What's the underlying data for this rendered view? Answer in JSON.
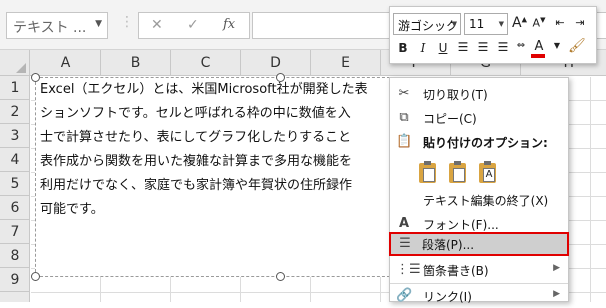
{
  "formula_bar": {
    "name_box": "テキスト ...",
    "cancel_icon": "✕",
    "enter_icon": "✓",
    "fx_label": "fx"
  },
  "columns": [
    "A",
    "B",
    "C",
    "D",
    "E",
    "F",
    "G",
    "H"
  ],
  "rows": [
    "1",
    "2",
    "3",
    "4",
    "5",
    "6",
    "7",
    "8",
    "9"
  ],
  "textbox": {
    "lines": [
      "Excel（エクセル）とは、米国Microsoft社が開発した表",
      "ションソフトです。セルと呼ばれる枠の中に数値を入",
      "士で計算させたり、表にしてグラフ化したりすること",
      "表作成から関数を用いた複雑な計算まで多用な機能を",
      "利用だけでなく、家庭でも家計簿や年賀状の住所録作",
      "可能です。"
    ]
  },
  "mini_toolbar": {
    "font_name": "游ゴシック",
    "font_size": "11",
    "grow_font": "A",
    "shrink_font": "A",
    "bold": "B",
    "italic": "I",
    "underline": "U",
    "font_color": "A",
    "font_color_hex": "#e00000"
  },
  "context_menu": {
    "items": [
      {
        "label": "切り取り(T)",
        "icon": "scissors-icon"
      },
      {
        "label": "コピー(C)",
        "icon": "copy-icon"
      },
      {
        "label": "貼り付けのオプション:",
        "icon": "paste-icon"
      },
      {
        "label": "テキスト編集の終了(X)",
        "icon": ""
      },
      {
        "label": "フォント(F)...",
        "icon": "font-icon"
      },
      {
        "label": "段落(P)...",
        "icon": "paragraph-icon"
      },
      {
        "label": "箇条書き(B)",
        "icon": "bullets-icon"
      },
      {
        "label": "リンク(I)",
        "icon": "link-icon"
      }
    ],
    "highlight_color": "#e00000"
  }
}
